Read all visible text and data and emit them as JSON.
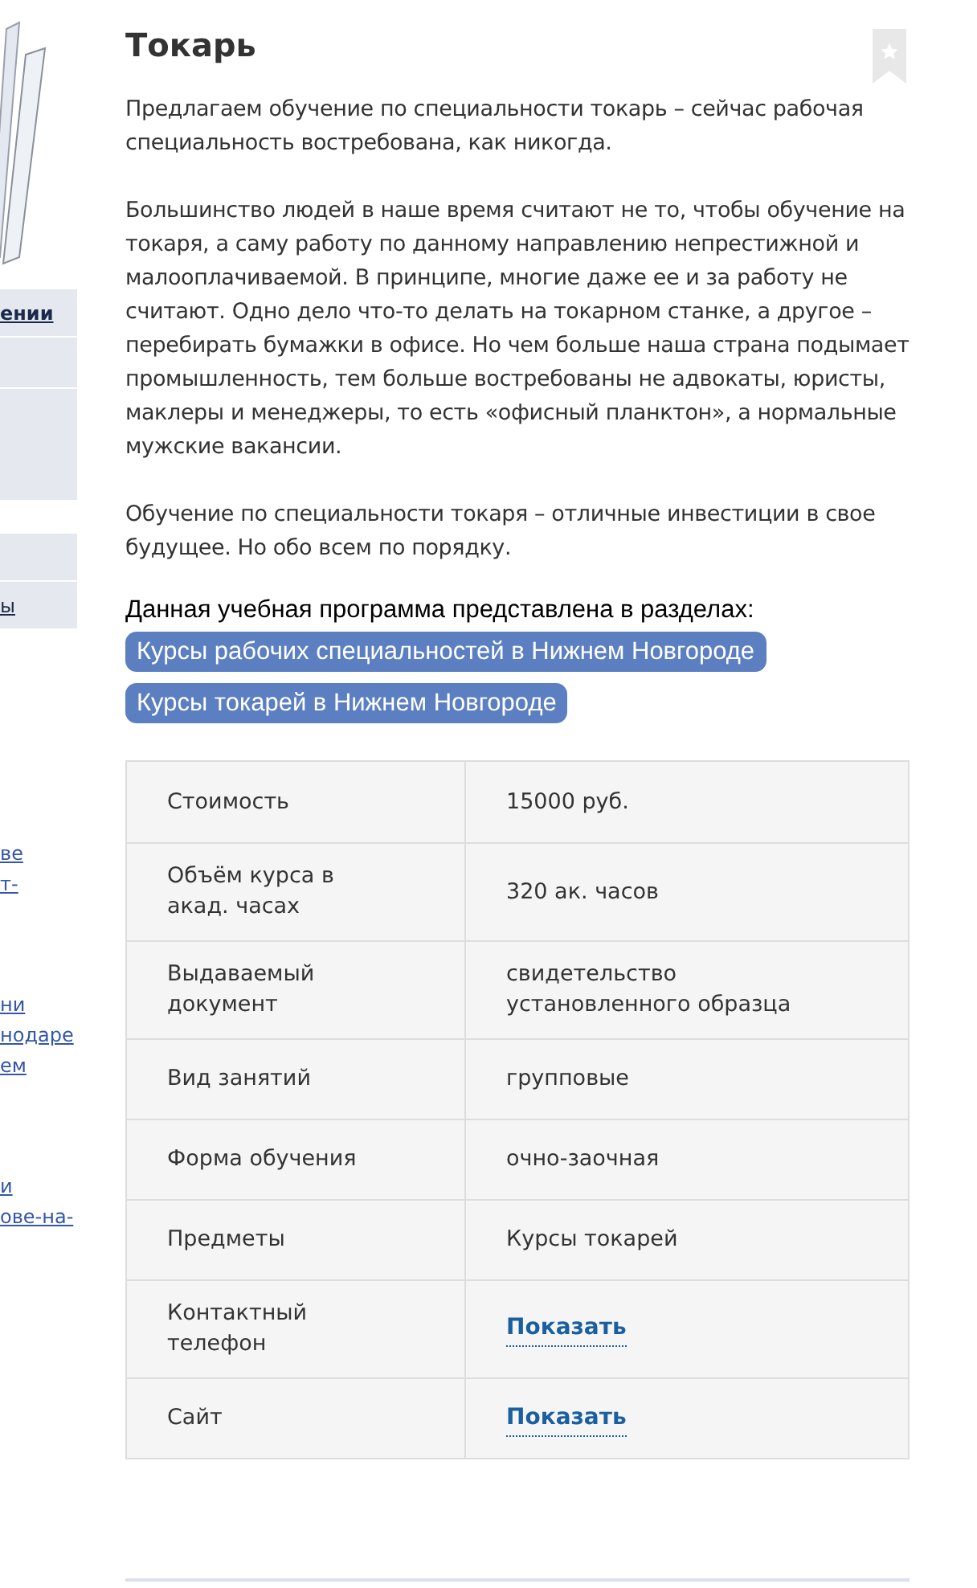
{
  "sidebar": {
    "menu": [
      {
        "kind": "link",
        "label": "ении"
      },
      {
        "kind": "blank"
      },
      {
        "kind": "blank"
      },
      {
        "kind": "blank"
      },
      {
        "kind": "link",
        "label": "ы"
      }
    ],
    "link_groups": [
      [
        "ве",
        "т-"
      ],
      [
        "ни",
        "нодаре",
        "ем"
      ],
      [
        "и",
        "ове-на-"
      ]
    ]
  },
  "article": {
    "title": "Токарь",
    "paragraphs": [
      "Предлагаем обучение по специальности токарь – сейчас рабочая специальность востребована, как никогда.",
      "Большинство людей в наше время считают не то, чтобы обучение на токаря, а саму работу по данному направлению непрестижной и малооплачиваемой. В принципе, многие даже ее и за работу не считают. Одно дело что-то делать на токарном станке, а другое – перебирать бумажки в офисе. Но чем больше наша страна подымает промышленность, тем больше востребованы не адвокаты, юристы, маклеры и менеджеры, то есть «офисный планктон», а нормальные мужские вакансии.",
      "Обучение по специальности токаря – отличные инвестиции в свое будущее. Но обо всем по порядку."
    ],
    "sections_label": "Данная учебная программа представлена в разделах:",
    "section_tags": [
      "Курсы рабочих специальностей в Нижнем Новгороде",
      "Курсы токарей в Нижнем Новгороде"
    ]
  },
  "details": [
    {
      "label": "Стоимость",
      "value": "15000 руб.",
      "kind": "text"
    },
    {
      "label": "Объём курса в акад. часах",
      "value": "320 ак. часов",
      "kind": "text"
    },
    {
      "label": "Выдаваемый документ",
      "value": "свидетельство установленного образца",
      "kind": "text"
    },
    {
      "label": "Вид занятий",
      "value": "групповые",
      "kind": "text"
    },
    {
      "label": "Форма обучения",
      "value": "очно-заочная",
      "kind": "text"
    },
    {
      "label": "Предметы",
      "value": "Курсы токарей",
      "kind": "text"
    },
    {
      "label": "Контактный телефон",
      "value": "Показать",
      "kind": "link"
    },
    {
      "label": "Сайт",
      "value": "Показать",
      "kind": "link"
    }
  ]
}
